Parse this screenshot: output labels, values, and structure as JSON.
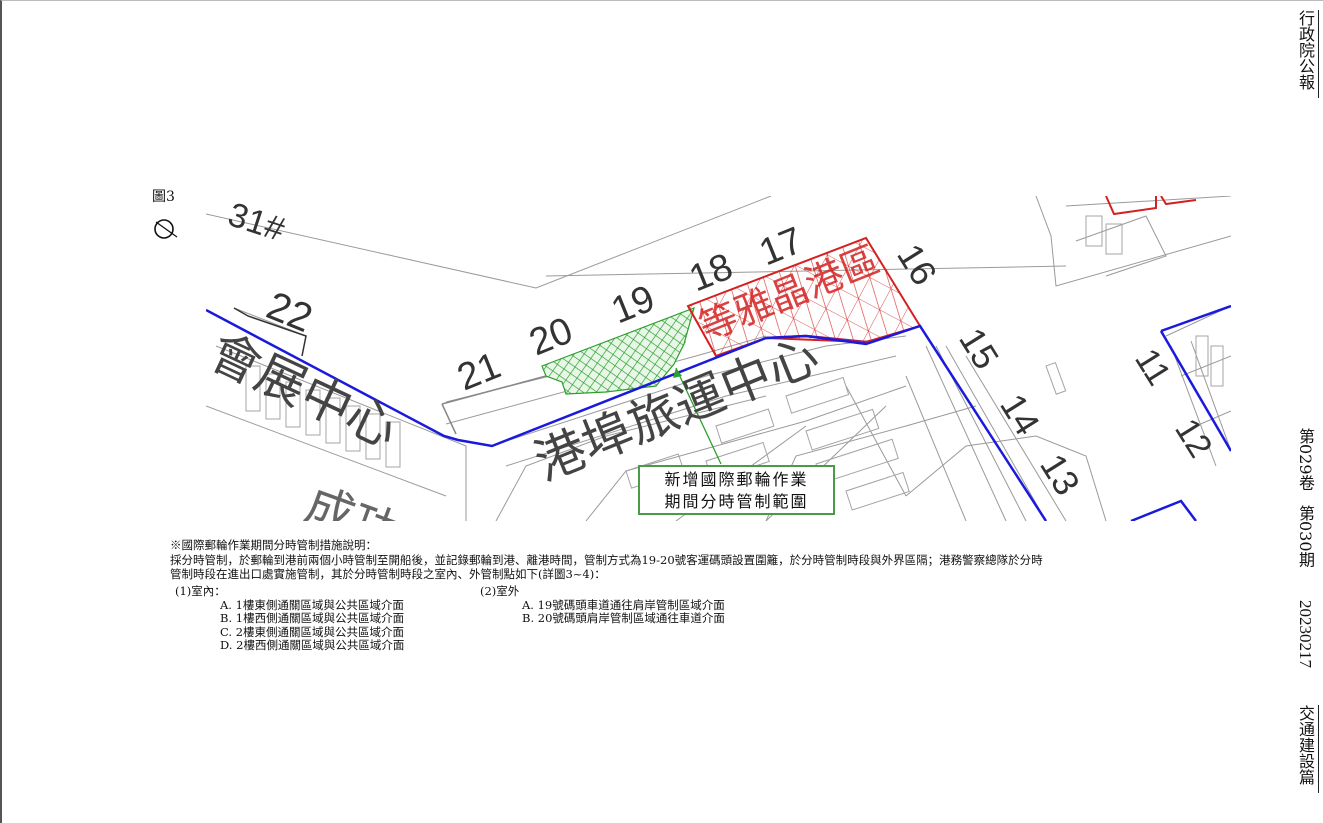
{
  "sidebar": {
    "publication": "行政院公報",
    "volume": "第029卷",
    "issue": "第030期",
    "date": "20230217",
    "section": "交通建設篇"
  },
  "figure": {
    "label": "圖3",
    "north_icon": "compass-north-icon"
  },
  "map": {
    "berths": [
      "31#",
      "22",
      "21",
      "20",
      "19",
      "18",
      "17",
      "16",
      "15",
      "14",
      "13",
      "12",
      "11"
    ],
    "areas": {
      "terminal": "港埠旅運中心",
      "exhibition": "會展中心",
      "red_zone": "等雅晶港區",
      "bottom_partial": "成功"
    },
    "callout": [
      "新增國際郵輪作業",
      "期間分時管制範圍"
    ],
    "colors": {
      "boundary_blue": "#1a1adc",
      "zone_red": "#d42020",
      "hatch_green": "#2ca02c"
    }
  },
  "notes": {
    "title": "※國際郵輪作業期間分時管制措施說明：",
    "body_line1": "採分時管制，於郵輪到港前兩個小時管制至開船後，並記錄郵輪到港、離港時間，管制方式為19-20號客運碼頭設置圍籬，於分時管制時段與外界區隔；港務警察總隊於分時",
    "body_line2": "管制時段在進出口處實施管制，其於分時管制時段之室內、外管制點如下(詳圖3~4)：",
    "indoor": {
      "heading": "(1)室內：",
      "items": [
        "A. 1樓東側通關區域與公共區域介面",
        "B. 1樓西側通關區域與公共區域介面",
        "C. 2樓東側通關區域與公共區域介面",
        "D. 2樓西側通關區域與公共區域介面"
      ]
    },
    "outdoor": {
      "heading": "(2)室外",
      "items": [
        "A. 19號碼頭車道通往肩岸管制區域介面",
        "B. 20號碼頭肩岸管制區域通往車道介面"
      ]
    }
  }
}
